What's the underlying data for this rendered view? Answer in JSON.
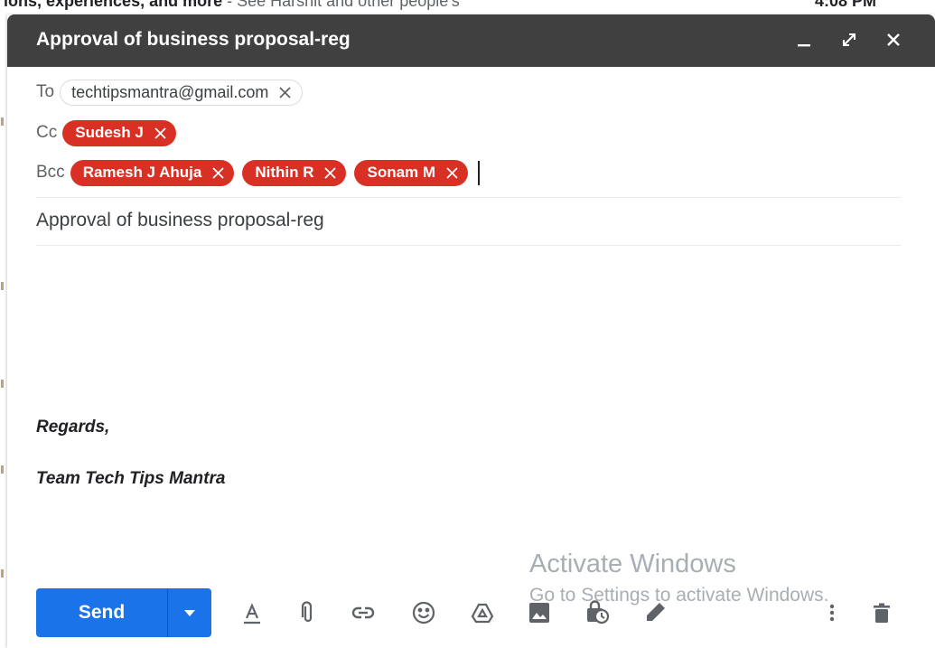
{
  "background": {
    "snippet_subject": "ions, experiences, and more",
    "snippet_preview": " - See Harshit and other people's",
    "time": "4:08 PM"
  },
  "compose": {
    "title": "Approval of business proposal-reg",
    "to_label": "To",
    "to": [
      {
        "label": "techtipsmantra@gmail.com"
      }
    ],
    "cc_label": "Cc",
    "cc": [
      {
        "label": "Sudesh J"
      }
    ],
    "bcc_label": "Bcc",
    "bcc": [
      {
        "label": "Ramesh J Ahuja"
      },
      {
        "label": "Nithin R"
      },
      {
        "label": "Sonam M"
      }
    ],
    "subject": "Approval of business proposal-reg",
    "signature_line1": "Regards,",
    "signature_line2": "Team Tech Tips Mantra",
    "send_label": "Send",
    "chip_color": "#d93025",
    "send_color": "#1a73e8",
    "titlebar_color": "#404040"
  },
  "titlebar_controls": [
    "minimize-icon",
    "expand-icon",
    "close-icon"
  ],
  "toolbar_icons": [
    "formatting-options-icon",
    "attach-file-icon",
    "insert-link-icon",
    "insert-emoji-icon",
    "google-drive-icon",
    "insert-photo-icon",
    "confidential-mode-icon",
    "signature-icon",
    "more-options-icon",
    "discard-draft-icon"
  ],
  "watermark": {
    "line1": "Activate Windows",
    "line2": "Go to Settings to activate Windows."
  }
}
